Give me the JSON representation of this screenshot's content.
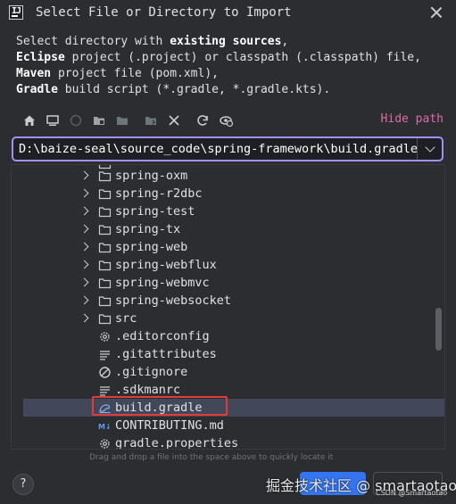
{
  "window": {
    "title": "Select File or Directory to Import",
    "app_icon_text": "IJ"
  },
  "description": {
    "line1_pre": "Select directory with ",
    "line1_bold": "existing sources",
    "line1_post": ",",
    "line2_bold": "Eclipse",
    "line2_post": " project (.project) or classpath (.classpath) file,",
    "line3_bold": "Maven",
    "line3_post": " project file (pom.xml),",
    "line4_bold": "Gradle",
    "line4_post": " build script (*.gradle, *.gradle.kts)."
  },
  "toolbar": {
    "hide_path_label": "Hide path"
  },
  "path": {
    "value": "D:\\baize-seal\\source_code\\spring-framework\\build.gradle"
  },
  "tree": {
    "items": [
      {
        "label": "spring-oxm",
        "type": "folder"
      },
      {
        "label": "spring-r2dbc",
        "type": "folder"
      },
      {
        "label": "spring-test",
        "type": "folder"
      },
      {
        "label": "spring-tx",
        "type": "folder"
      },
      {
        "label": "spring-web",
        "type": "folder"
      },
      {
        "label": "spring-webflux",
        "type": "folder"
      },
      {
        "label": "spring-webmvc",
        "type": "folder"
      },
      {
        "label": "spring-websocket",
        "type": "folder"
      },
      {
        "label": "src",
        "type": "folder"
      },
      {
        "label": ".editorconfig",
        "type": "config-file"
      },
      {
        "label": ".gitattributes",
        "type": "text-file"
      },
      {
        "label": ".gitignore",
        "type": "ignore-file"
      },
      {
        "label": ".sdkmanrc",
        "type": "text-file"
      },
      {
        "label": "build.gradle",
        "type": "gradle-file",
        "selected": true
      },
      {
        "label": "CONTRIBUTING.md",
        "type": "markdown-file"
      },
      {
        "label": "gradle.properties",
        "type": "properties-file"
      }
    ]
  },
  "drag_hint": "Drag and drop a file into the space above to quickly locate it",
  "help_label": "?",
  "watermark": {
    "main": "掘金技术社区 @ smartaotao",
    "sub": "CSDN @Smartaotao"
  },
  "colors": {
    "background": "#2b2d30",
    "accent": "#3574f0",
    "path_border": "#a58ff2",
    "hide_path": "#e06aa8",
    "selection": "#43475a",
    "highlight_box": "#e23b3b"
  }
}
